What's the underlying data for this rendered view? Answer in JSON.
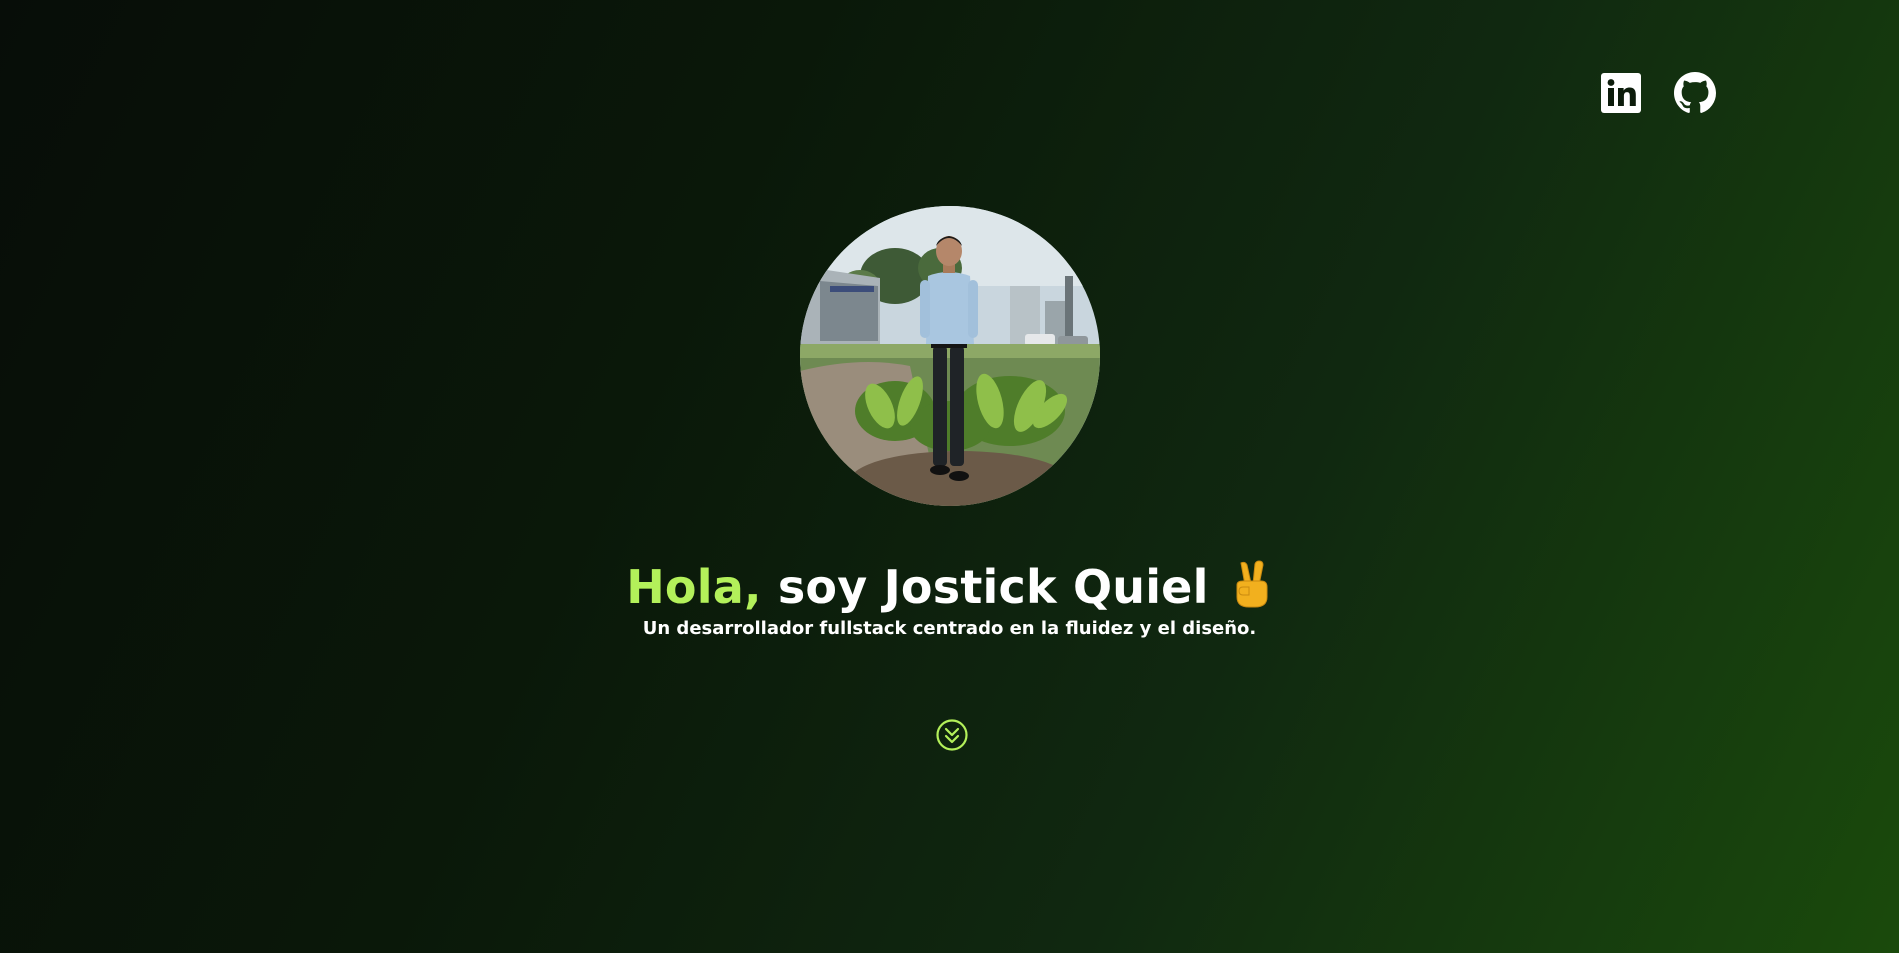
{
  "social": {
    "linkedin": {
      "icon": "linkedin-icon",
      "color": "#ffffff"
    },
    "github": {
      "icon": "github-icon",
      "color": "#ffffff"
    }
  },
  "hero": {
    "avatar_icon": "profile-photo",
    "greeting": "Hola,",
    "intro": " soy Jostick Quiel",
    "emoji_icon": "victory-hand-emoji",
    "subtitle": "Un desarrollador fullstack centrado en la fluidez y el diseño.",
    "scroll_icon": "chevrons-down-circle-icon"
  },
  "colors": {
    "accent": "#b3f05a",
    "background_dark": "#070d08",
    "background_green": "#1a4a0c",
    "text": "#ffffff"
  }
}
